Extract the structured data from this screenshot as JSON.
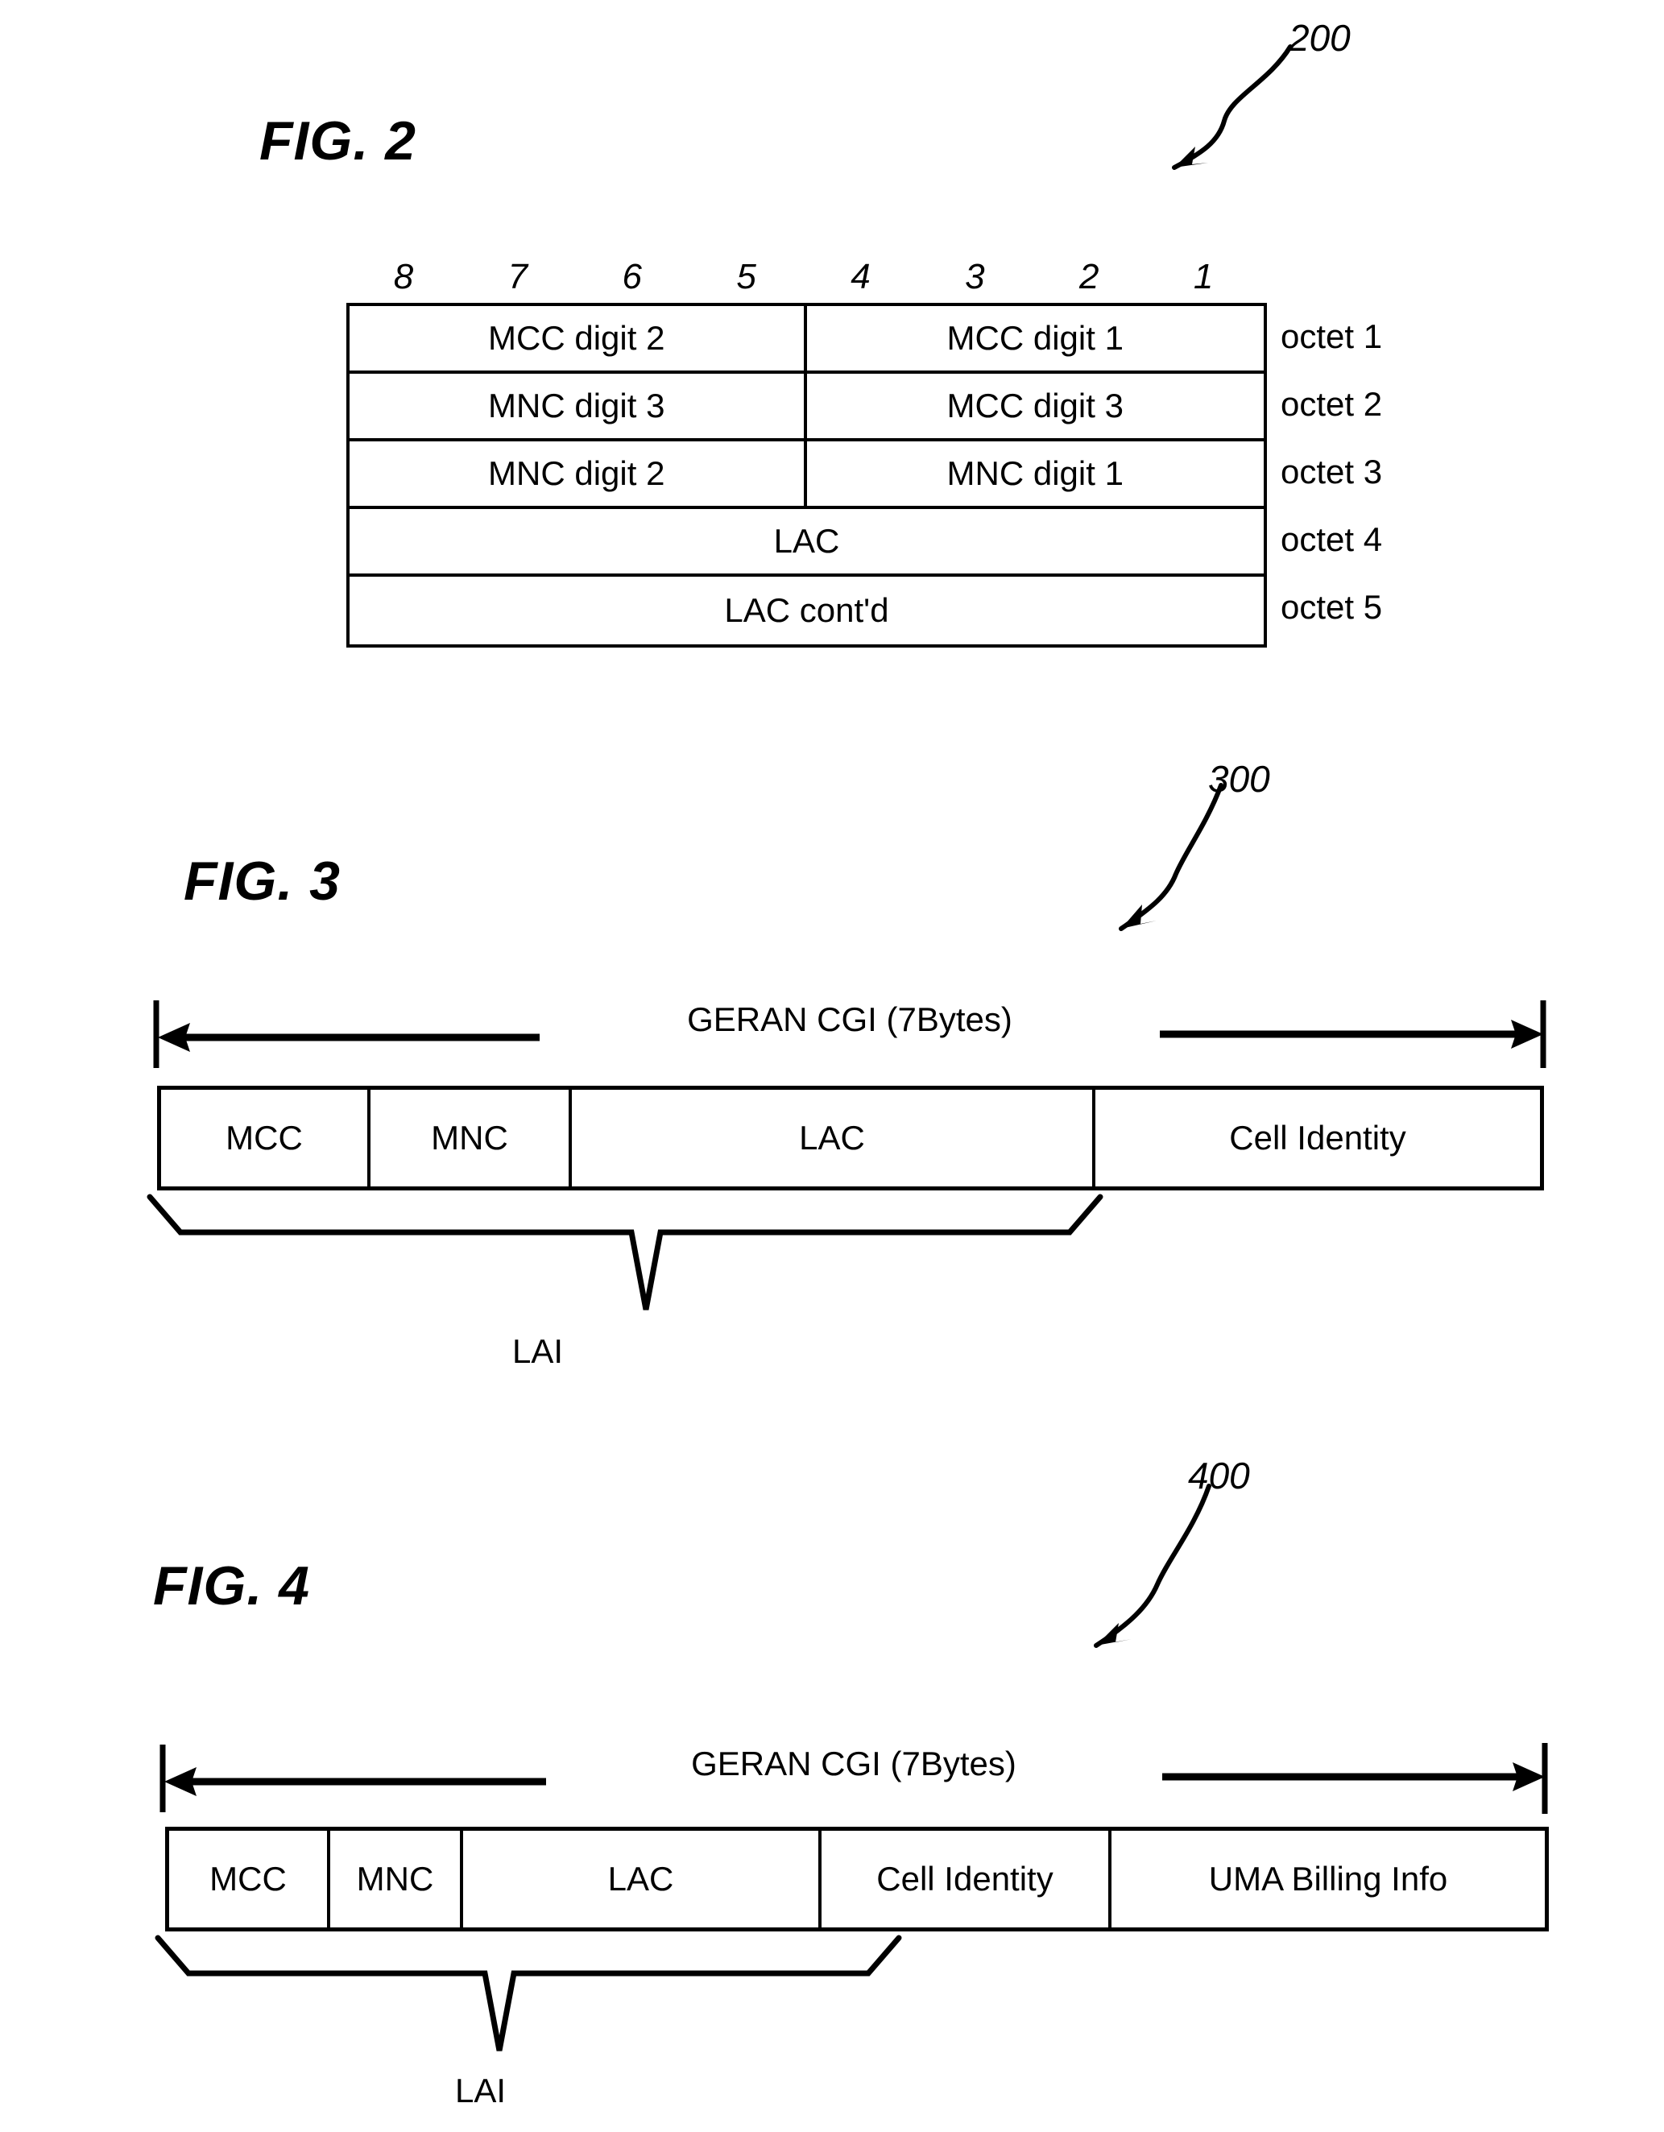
{
  "figures": {
    "fig2": {
      "title": "FIG. 2",
      "ref": "200",
      "bit_header": [
        "8",
        "7",
        "6",
        "5",
        "4",
        "3",
        "2",
        "1"
      ],
      "rows": [
        {
          "octet": "octet 1",
          "split": true,
          "left": "MCC digit 2",
          "right": "MCC digit 1"
        },
        {
          "octet": "octet 2",
          "split": true,
          "left": "MNC digit 3",
          "right": "MCC digit 3"
        },
        {
          "octet": "octet 3",
          "split": true,
          "left": "MNC digit 2",
          "right": "MNC digit 1"
        },
        {
          "octet": "octet 4",
          "split": false,
          "full": "LAC"
        },
        {
          "octet": "octet 5",
          "split": false,
          "full": "LAC cont'd"
        }
      ],
      "r0_left": "MCC digit 2",
      "r0_right": "MCC digit 1",
      "r1_left": "MNC digit 3",
      "r1_right": "MCC digit 3",
      "r2_left": "MNC digit 2",
      "r2_right": "MNC digit 1",
      "r3_full": "LAC",
      "r4_full": "LAC cont'd",
      "octet1": "octet 1",
      "octet2": "octet 2",
      "octet3": "octet 3",
      "octet4": "octet 4",
      "octet5": "octet 5",
      "bit8": "8",
      "bit7": "7",
      "bit6": "6",
      "bit5": "5",
      "bit4": "4",
      "bit3": "3",
      "bit2": "2",
      "bit1": "1"
    },
    "fig3": {
      "title": "FIG. 3",
      "ref": "300",
      "span_label": "GERAN CGI (7Bytes)",
      "fields": [
        "MCC",
        "MNC",
        "LAC",
        "Cell Identity"
      ],
      "f0": "MCC",
      "f1": "MNC",
      "f2": "LAC",
      "f3": "Cell Identity",
      "brace_label": "LAI"
    },
    "fig4": {
      "title": "FIG. 4",
      "ref": "400",
      "span_label": "GERAN CGI (7Bytes)",
      "fields": [
        "MCC",
        "MNC",
        "LAC",
        "Cell Identity",
        "UMA Billing Info"
      ],
      "f0": "MCC",
      "f1": "MNC",
      "f2": "LAC",
      "f3": "Cell Identity",
      "f4": "UMA Billing Info",
      "brace_label": "LAI"
    }
  },
  "colors": {
    "ink": "#000000",
    "paper": "#ffffff"
  }
}
